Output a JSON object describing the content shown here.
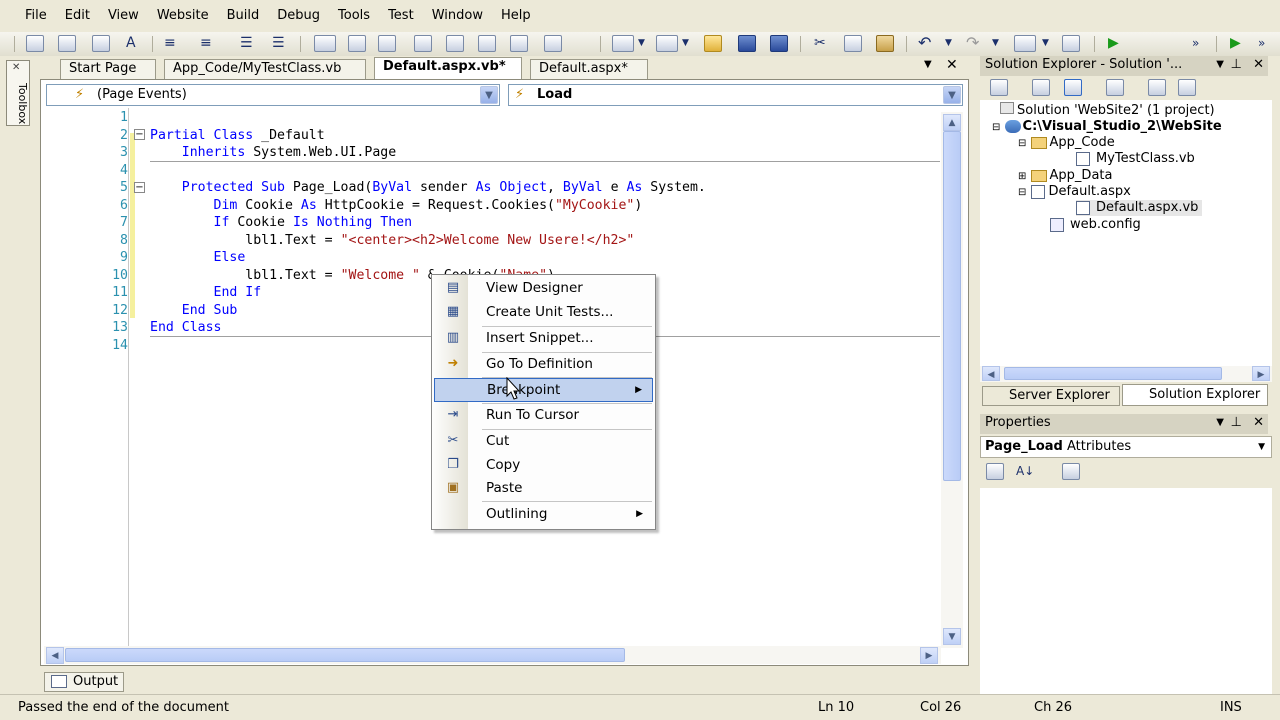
{
  "menu": [
    "File",
    "Edit",
    "View",
    "Website",
    "Build",
    "Debug",
    "Tools",
    "Test",
    "Window",
    "Help"
  ],
  "toolbox": {
    "label": "Toolbox"
  },
  "tabs": [
    "Start Page",
    "App_Code/MyTestClass.vb",
    "Default.aspx.vb*",
    "Default.aspx*"
  ],
  "combos": {
    "left": "(Page Events)",
    "right": "Load"
  },
  "code": [
    {
      "n": "1",
      "parts": []
    },
    {
      "n": "2",
      "parts": [
        {
          "t": "Partial Class",
          "c": "kw"
        },
        {
          "t": " _Default",
          "c": ""
        }
      ]
    },
    {
      "n": "3",
      "parts": [
        {
          "t": "    Inherits",
          "c": "kw"
        },
        {
          "t": " System.Web.UI.Page",
          "c": ""
        }
      ]
    },
    {
      "n": "4",
      "parts": []
    },
    {
      "n": "5",
      "parts": [
        {
          "t": "    Protected Sub",
          "c": "kw"
        },
        {
          "t": " Page_Load(",
          "c": ""
        },
        {
          "t": "ByVal",
          "c": "kw"
        },
        {
          "t": " sender ",
          "c": ""
        },
        {
          "t": "As Object",
          "c": "kw"
        },
        {
          "t": ", ",
          "c": ""
        },
        {
          "t": "ByVal",
          "c": "kw"
        },
        {
          "t": " e ",
          "c": ""
        },
        {
          "t": "As",
          "c": "kw"
        },
        {
          "t": " System.",
          "c": ""
        }
      ]
    },
    {
      "n": "6",
      "parts": [
        {
          "t": "        Dim",
          "c": "kw"
        },
        {
          "t": " Cookie ",
          "c": ""
        },
        {
          "t": "As",
          "c": "kw"
        },
        {
          "t": " HttpCookie = Request.Cookies(",
          "c": ""
        },
        {
          "t": "\"MyCookie\"",
          "c": "st"
        },
        {
          "t": ")",
          "c": ""
        }
      ]
    },
    {
      "n": "7",
      "parts": [
        {
          "t": "        If",
          "c": "kw"
        },
        {
          "t": " Cookie ",
          "c": ""
        },
        {
          "t": "Is Nothing Then",
          "c": "kw"
        }
      ]
    },
    {
      "n": "8",
      "parts": [
        {
          "t": "            lbl1.Text = ",
          "c": ""
        },
        {
          "t": "\"<center><h2>Welcome New Usere!</h2>\"",
          "c": "st"
        }
      ]
    },
    {
      "n": "9",
      "parts": [
        {
          "t": "        Else",
          "c": "kw"
        }
      ]
    },
    {
      "n": "10",
      "parts": [
        {
          "t": "            lbl1.Text = ",
          "c": ""
        },
        {
          "t": "\"Welcome \"",
          "c": "st"
        },
        {
          "t": " & Cookie(",
          "c": ""
        },
        {
          "t": "\"Name\"",
          "c": "st"
        },
        {
          "t": ")",
          "c": ""
        }
      ]
    },
    {
      "n": "11",
      "parts": [
        {
          "t": "        End If",
          "c": "kw"
        }
      ]
    },
    {
      "n": "12",
      "parts": [
        {
          "t": "    End Sub",
          "c": "kw"
        }
      ]
    },
    {
      "n": "13",
      "parts": [
        {
          "t": "End Class",
          "c": "kw"
        }
      ]
    },
    {
      "n": "14",
      "parts": []
    }
  ],
  "context_menu": {
    "items": [
      "View Designer",
      "Create Unit Tests...",
      "Insert Snippet...",
      "Go To Definition",
      "Breakpoint",
      "Run To Cursor",
      "Cut",
      "Copy",
      "Paste",
      "Outlining"
    ]
  },
  "solution_explorer": {
    "title": "Solution Explorer - Solution '...",
    "nodes": [
      "Solution 'WebSite2' (1 project)",
      "C:\\Visual_Studio_2\\WebSite",
      "App_Code",
      "MyTestClass.vb",
      "App_Data",
      "Default.aspx",
      "Default.aspx.vb",
      "web.config"
    ],
    "tabs": [
      "Server Explorer",
      "Solution Explorer"
    ]
  },
  "properties": {
    "title": "Properties",
    "object": "Page_Load",
    "object_type": "Attributes"
  },
  "output_tab": "Output",
  "status": {
    "message": "Passed the end of the document",
    "ln": "Ln 10",
    "col": "Col 26",
    "ch": "Ch 26",
    "mode": "INS"
  }
}
